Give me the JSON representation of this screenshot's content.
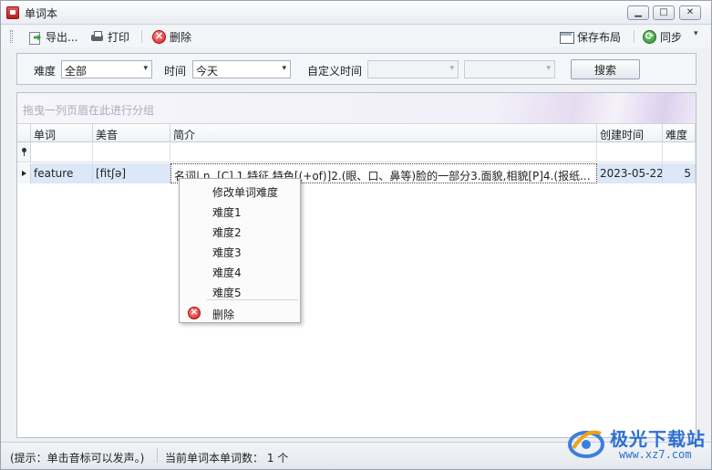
{
  "window": {
    "title": "单词本",
    "minimize_label": "▁",
    "maximize_label": "□",
    "close_label": "✕"
  },
  "toolbar": {
    "export_label": "导出...",
    "print_label": "打印",
    "delete_label": "删除",
    "save_layout_label": "保存布局",
    "sync_label": "同步",
    "dropdown_arrow": "▾"
  },
  "filter": {
    "difficulty_label": "难度",
    "difficulty_value": "全部",
    "time_label": "时间",
    "time_value": "今天",
    "custom_time_label": "自定义时间",
    "custom_time_start": "",
    "custom_time_end": "",
    "search_label": "搜索",
    "arrow": "▾"
  },
  "grid": {
    "group_hint": "拖曳一列页眉在此进行分组",
    "columns": [
      "单词",
      "美音",
      "简介",
      "创建时间",
      "难度"
    ],
    "rows": [
      {
        "word": "feature",
        "phonetic": "[fitʃə]",
        "summary": "名词| n. [C] 1.特征,特色[(+of)]2.(眼、口、鼻等)脸的一部分3.面貌,相貌[P]4.(报纸...",
        "created": "2023-05-22",
        "difficulty": "5"
      }
    ]
  },
  "context_menu": {
    "items": [
      "修改单词难度",
      "难度1",
      "难度2",
      "难度3",
      "难度4",
      "难度5"
    ],
    "delete_label": "删除"
  },
  "status": {
    "hint": "(提示：单击音标可以发声。)",
    "count_text": "当前单词本单词数： 1 个"
  },
  "watermark": {
    "title": "极光下载站",
    "url": "www.xz7.com"
  }
}
